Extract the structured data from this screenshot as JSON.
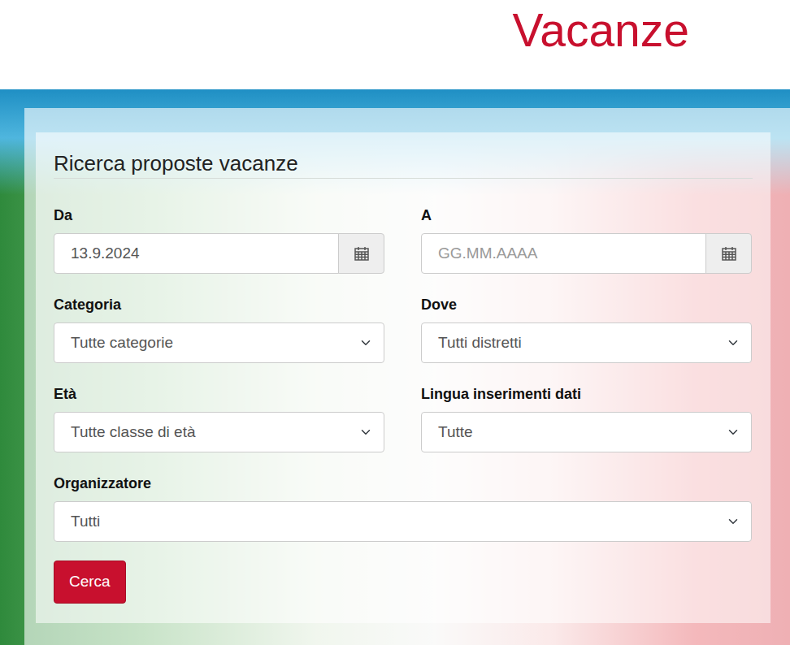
{
  "header": {
    "title": "Vacanze"
  },
  "form": {
    "title": "Ricerca proposte vacanze",
    "dates": [
      {
        "label": "Da",
        "value": "13.9.2024"
      },
      {
        "label": "A",
        "placeholder": "GG.MM.AAAA"
      }
    ],
    "selects": [
      {
        "label": "Categoria",
        "value": "Tutte categorie"
      },
      {
        "label": "Dove",
        "value": "Tutti distretti"
      },
      {
        "label": "Età",
        "value": "Tutte classe di età"
      },
      {
        "label": "Lingua inserimenti dati",
        "value": "Tutte"
      }
    ],
    "organizer": {
      "label": "Organizzatore",
      "value": "Tutti"
    },
    "button": "Cerca"
  }
}
